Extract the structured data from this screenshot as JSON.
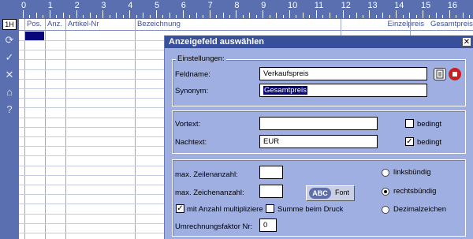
{
  "ruler": {
    "numbers": [
      "0",
      "1",
      "2",
      "3",
      "4",
      "5",
      "6",
      "7",
      "8",
      "9",
      "10",
      "11",
      "12",
      "13",
      "14",
      "15",
      "16"
    ]
  },
  "left_toolbar": {
    "mode_label": "1H",
    "icons": [
      "refresh-icon",
      "checkmark-icon",
      "cancel-icon",
      "building-icon",
      "help-icon"
    ],
    "icon_glyphs": [
      "⟳",
      "✓",
      "✕",
      "⌂",
      "?"
    ]
  },
  "grid": {
    "columns": [
      "Pos.",
      "Anz.",
      "Artikel-Nr",
      "Bezeichnung",
      "Einzelpreis",
      "Gesamtpreis"
    ]
  },
  "dialog": {
    "title": "Anzeigefeld auswählen",
    "close_glyph": "✕",
    "settings_group": "Einstellungen:",
    "fieldname_label": "Feldname:",
    "fieldname_value": "Verkaufspreis",
    "synonym_label": "Synonym:",
    "synonym_value": "Gesamtpreis",
    "vortext_label": "Vortext:",
    "vortext_value": "",
    "vortext_conditional_label": "bedingt",
    "vortext_conditional_checked": false,
    "nachtext_label": "Nachtext:",
    "nachtext_value": "EUR",
    "nachtext_conditional_label": "bedingt",
    "nachtext_conditional_checked": true,
    "max_lines_label": "max. Zeilenanzahl:",
    "max_lines_value": "",
    "max_chars_label": "max. Zeichenanzahl:",
    "max_chars_value": "",
    "font_badge": "ABC",
    "font_label": "Font",
    "multiply_label": "mit Anzahl multipliziere",
    "multiply_checked": true,
    "sum_label": "Summe beim Druck",
    "sum_checked": false,
    "conversion_label": "Umrechnungsfaktor Nr:",
    "conversion_value": "0",
    "align_left_label": "linksbündig",
    "align_right_label": "rechtsbündig",
    "decimal_label": "Dezimalzeichen",
    "alignment_selected": "rechtsbündig"
  },
  "colors": {
    "toolbar": "#5a6fb0",
    "dialog_bg": "#9fafe2",
    "title_bar": "#384f9c",
    "selection": "#06067a"
  }
}
